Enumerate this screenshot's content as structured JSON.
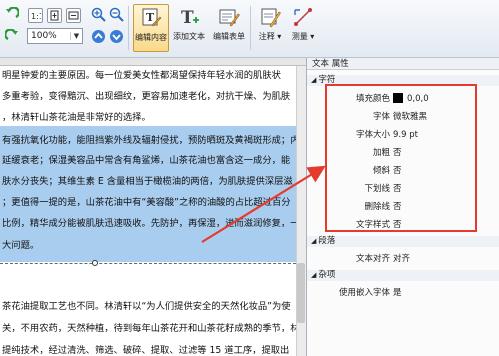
{
  "toolbar": {
    "zoom_value": "100%",
    "buttons": [
      {
        "label": "编辑内容"
      },
      {
        "label": "添加文本"
      },
      {
        "label": "编辑表单"
      },
      {
        "label": "注释"
      },
      {
        "label": "测量"
      }
    ]
  },
  "document": {
    "lines": [
      "明星钟爱的主要原因。每一位爱美女性都渴望保持年轻水润的肌肤状",
      "多重考验，变得黯沉、出现细纹，更容易加速老化，对抗干燥、为肌肤",
      "，林清轩山茶花油是非常好的选择。",
      "有强抗氧化功能，能阻挡紫外线及辐射侵扰，预防晒斑及黄褐斑形成；内",
      "延缓衰老；保湿美容品中常含有角鲨烯，山茶花油也富含这一成分，能",
      "肤水分丧失；其维生素 E 含量相当于橄榄油的两倍，为肌肤提供深层滋",
      "；更值得一提的是，山茶花油中有“美容酸”之称的油酸的占比超过百分",
      "比例，精华成分能被肌肤迅速吸收。先防护，再保湿，进而滋润修复，一",
      "大问题。",
      "茶花油提取工艺也不同。林清轩以“为人们提供安全的天然化妆品”为使",
      "关，不用农药，天然种植，待到每年山茶花开和山茶花籽成熟的季节，林",
      "提纯技术，经过清洗、筛选、破碎、提取、过滤等 15 道工序，提取出"
    ]
  },
  "panel": {
    "title": "文本 属性",
    "sections": {
      "char": "字符",
      "para": "段落",
      "misc": "杂项"
    },
    "char_props": [
      {
        "key": "填充颜色",
        "value": "0,0,0"
      },
      {
        "key": "字体",
        "value": "微软雅黑"
      },
      {
        "key": "字体大小",
        "value": "9.9 pt"
      },
      {
        "key": "加粗",
        "value": "否"
      },
      {
        "key": "倾斜",
        "value": "否"
      },
      {
        "key": "下划线",
        "value": "否"
      },
      {
        "key": "删除线",
        "value": "否"
      },
      {
        "key": "文字样式",
        "value": "否"
      }
    ],
    "para_props": [
      {
        "key": "文本对齐",
        "value": "对齐"
      }
    ],
    "misc_props": [
      {
        "key": "使用嵌入字体",
        "value": "是"
      }
    ]
  },
  "colors": {
    "highlight_box": "#e53b2f",
    "selection": "#a9cdef",
    "fill_color": "#000000"
  }
}
